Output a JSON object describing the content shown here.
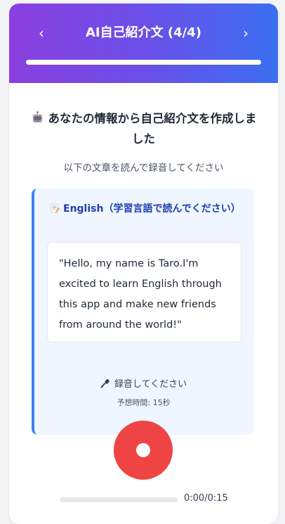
{
  "header": {
    "title": "AI自己紹介文 (4/4)",
    "prev_icon": "‹",
    "next_icon": "›",
    "progress_fraction": 1.0
  },
  "main": {
    "headline_icon": "robot-icon",
    "headline": "あなたの情報から自己紹介文を作成しました",
    "subtitle": "以下の文章を読んで録音してください",
    "lang_icon": "memo-icon",
    "lang_label": "English（学習言語で読んでください）",
    "sample_text": "\"Hello, my name is Taro.I'm excited to learn English through this app and make new friends from around the world!\""
  },
  "recording": {
    "mic_icon": "microphone-icon",
    "label": "録音してください",
    "estimate": "予想時間: 15秒",
    "time_display": "0:00/0:15",
    "playback_fraction": 0
  },
  "colors": {
    "header_gradient_start": "#8b3fe0",
    "header_gradient_end": "#3b6ff0",
    "accent_blue": "#3b82f6",
    "record_red": "#ef4444"
  }
}
